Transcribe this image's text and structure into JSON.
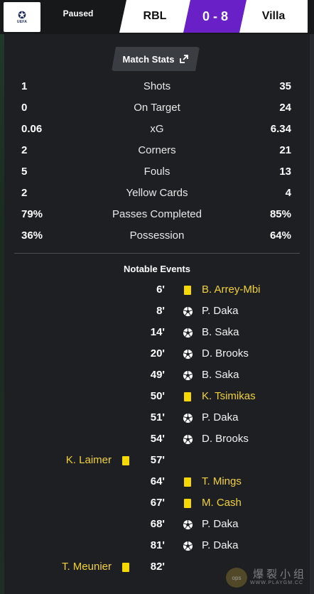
{
  "header": {
    "competition_logo": "champions-league-logo",
    "status": "Paused",
    "home_team": "RBL",
    "score": "0 - 8",
    "away_team": "Villa",
    "score_color": "#6a20c7"
  },
  "match_stats": {
    "button_label": "Match Stats",
    "rows": [
      {
        "home": "1",
        "label": "Shots",
        "away": "35"
      },
      {
        "home": "0",
        "label": "On Target",
        "away": "24"
      },
      {
        "home": "0.06",
        "label": "xG",
        "away": "6.34"
      },
      {
        "home": "2",
        "label": "Corners",
        "away": "21"
      },
      {
        "home": "5",
        "label": "Fouls",
        "away": "13"
      },
      {
        "home": "2",
        "label": "Yellow Cards",
        "away": "4"
      },
      {
        "home": "79%",
        "label": "Passes Completed",
        "away": "85%"
      },
      {
        "home": "36%",
        "label": "Possession",
        "away": "64%"
      }
    ]
  },
  "events": {
    "title": "Notable Events",
    "items": [
      {
        "minute": "6'",
        "side": "away",
        "type": "yellow-card",
        "player": "B. Arrey-Mbi"
      },
      {
        "minute": "8'",
        "side": "away",
        "type": "goal",
        "player": "P. Daka"
      },
      {
        "minute": "14'",
        "side": "away",
        "type": "goal",
        "player": "B. Saka"
      },
      {
        "minute": "20'",
        "side": "away",
        "type": "goal",
        "player": "D. Brooks"
      },
      {
        "minute": "49'",
        "side": "away",
        "type": "goal",
        "player": "B. Saka"
      },
      {
        "minute": "50'",
        "side": "away",
        "type": "yellow-card",
        "player": "K. Tsimikas"
      },
      {
        "minute": "51'",
        "side": "away",
        "type": "goal",
        "player": "P. Daka"
      },
      {
        "minute": "54'",
        "side": "away",
        "type": "goal",
        "player": "D. Brooks"
      },
      {
        "minute": "57'",
        "side": "home",
        "type": "yellow-card",
        "player": "K. Laimer"
      },
      {
        "minute": "64'",
        "side": "away",
        "type": "yellow-card",
        "player": "T. Mings"
      },
      {
        "minute": "67'",
        "side": "away",
        "type": "yellow-card",
        "player": "M. Cash"
      },
      {
        "minute": "68'",
        "side": "away",
        "type": "goal",
        "player": "P. Daka"
      },
      {
        "minute": "81'",
        "side": "away",
        "type": "goal",
        "player": "P. Daka"
      },
      {
        "minute": "82'",
        "side": "home",
        "type": "yellow-card",
        "player": "T. Meunier"
      }
    ]
  },
  "watermark": {
    "logo": "playgm-logo",
    "main": "爆裂小组",
    "sub": "WWW.PLAYGM.CC"
  }
}
